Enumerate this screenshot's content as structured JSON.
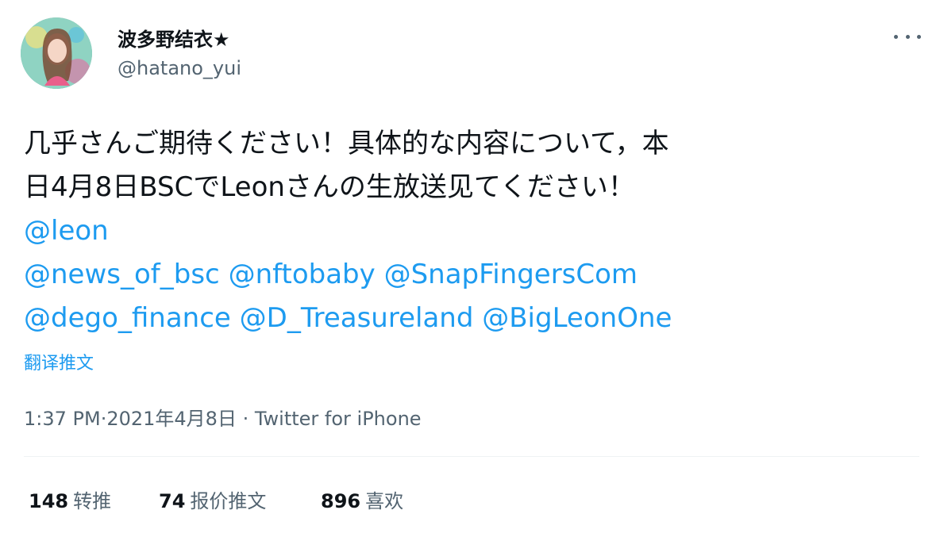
{
  "user": {
    "display_name": "波多野结衣★",
    "handle": "@hatano_yui"
  },
  "icons": {
    "more": "more-options-icon",
    "avatar": "avatar"
  },
  "tweet": {
    "line1": "几乎さんご期待ください！具体的な内容について，本",
    "line2": "日4月8日BSCでLeonさんの生放送见てください！",
    "mentions_row1": [
      "@leon"
    ],
    "mentions_row2": [
      "@news_of_bsc",
      "@nftobaby",
      "@SnapFingersCom"
    ],
    "mentions_row3": [
      "@dego_finance",
      "@D_Treasureland",
      "@BigLeonOne"
    ],
    "translate": "翻译推文"
  },
  "meta": {
    "time": "1:37 PM·2021年4月8日",
    "separator": " · ",
    "source": "Twitter for iPhone"
  },
  "stats": {
    "retweets_count": "148",
    "retweets_label": "转推",
    "quotes_count": "74",
    "quotes_label": "报价推文",
    "likes_count": "896",
    "likes_label": "喜欢"
  },
  "colors": {
    "link": "#1d9bf0",
    "secondary": "#536471",
    "text": "#0f1419"
  }
}
